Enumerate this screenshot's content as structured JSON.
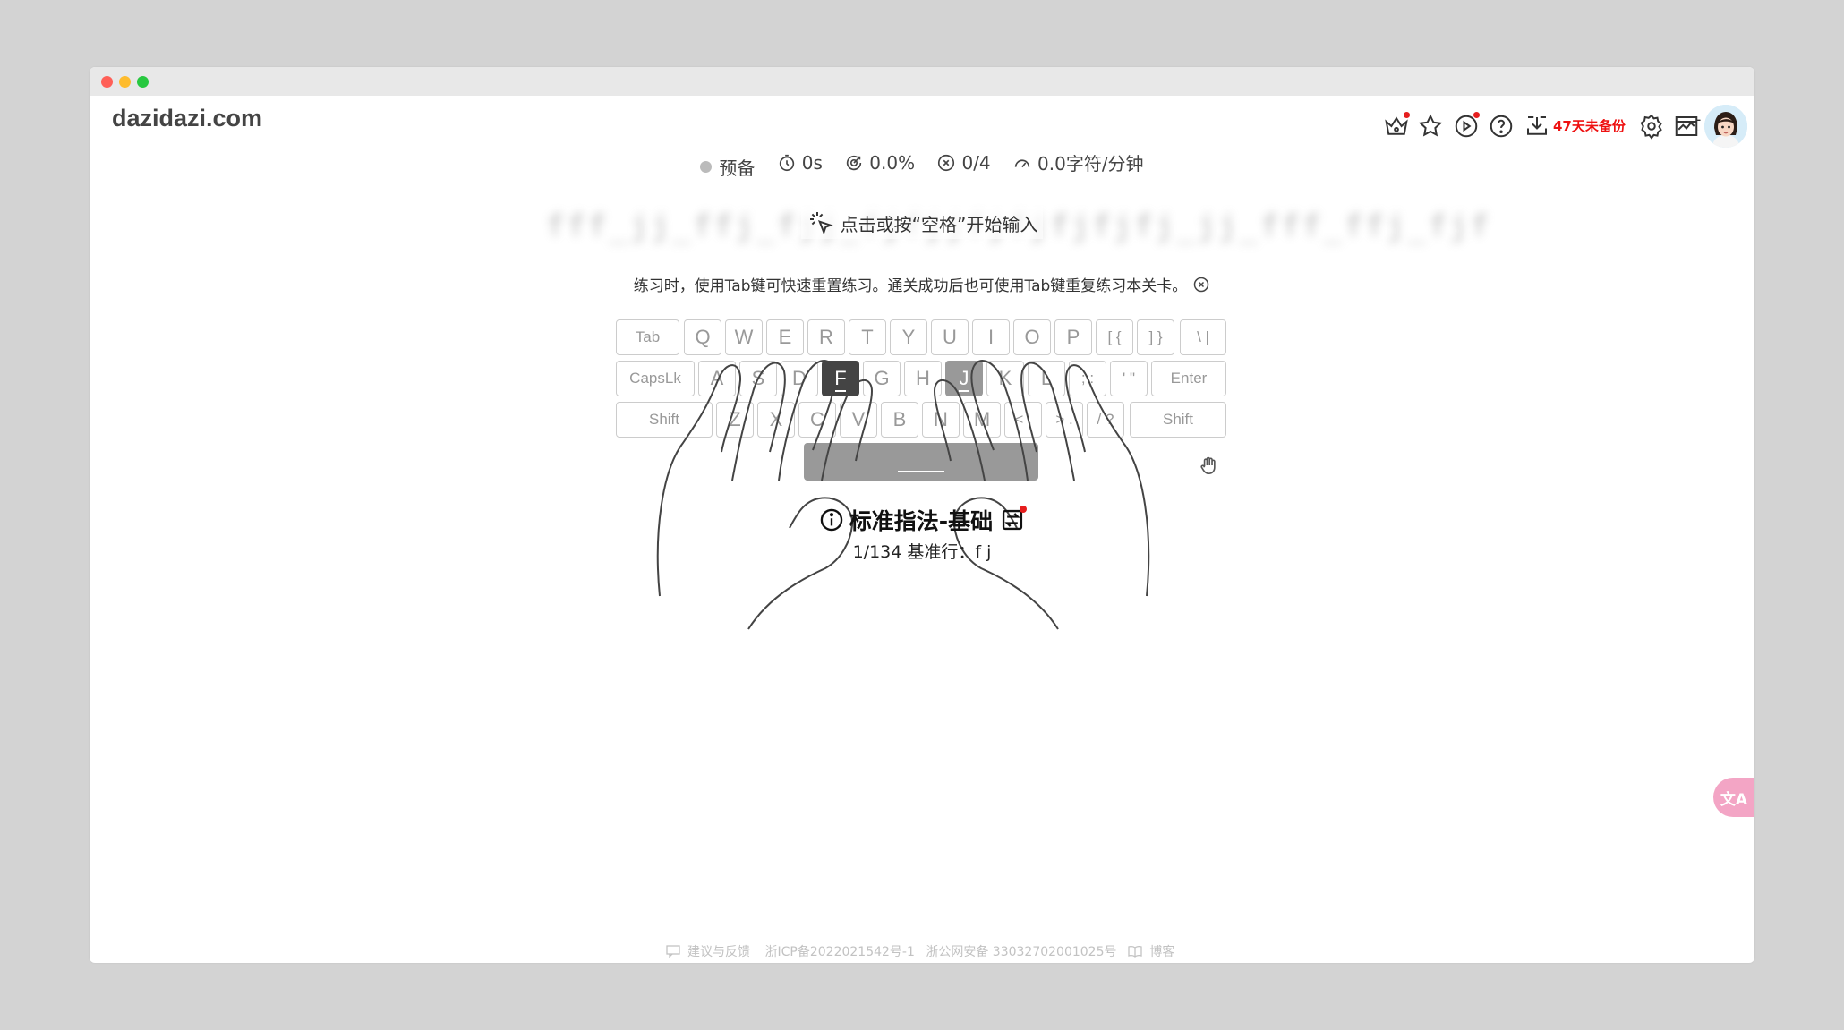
{
  "app": {
    "brand": "dazidazi.com"
  },
  "toolbar": {
    "backup_text": "47天未备份"
  },
  "status": {
    "state": "预备",
    "time": "0s",
    "accuracy": "0.0%",
    "errors": "0/4",
    "speed": "0.0字符/分钟"
  },
  "practice": {
    "blurred_text": "fff_jj_ffj_fjj_fjfjjfjfjfjfjfj_jj_fff_ffj_fjf",
    "start_hint": "点击或按“空格”开始输入",
    "tip": "练习时，使用Tab键可快速重置练习。通关成功后也可使用Tab键重复练习本关卡。"
  },
  "keyboard": {
    "rows": [
      [
        "Tab",
        "Q",
        "W",
        "E",
        "R",
        "T",
        "Y",
        "U",
        "I",
        "O",
        "P",
        "[ {",
        "] }",
        "\\ |"
      ],
      [
        "CapsLk",
        "A",
        "S",
        "D",
        "F",
        "G",
        "H",
        "J",
        "K",
        "L",
        "; :",
        "' \"",
        "Enter"
      ],
      [
        "Shift",
        "Z",
        "X",
        "C",
        "V",
        "B",
        "N",
        "M",
        "< ,",
        "> .",
        "/ ?",
        "Shift"
      ]
    ],
    "active_keys": [
      "F",
      "J"
    ]
  },
  "lesson": {
    "title": "标准指法-基础",
    "subtitle": "1/134 基准行：f j"
  },
  "translate_label": "文A",
  "footer": {
    "feedback": "建议与反馈",
    "icp": "浙ICP备2022021542号-1",
    "police": "浙公网安备 33032702001025号",
    "blog": "博客"
  },
  "colors": {
    "alert": "#e11111",
    "active_key": "#444444",
    "secondary_key": "#999999",
    "translate": "#f3a5c5"
  }
}
